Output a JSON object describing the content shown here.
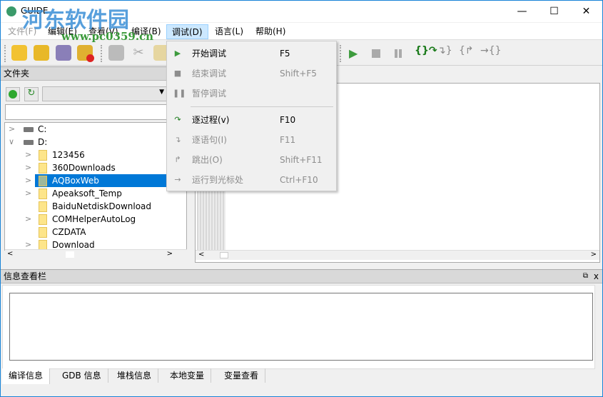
{
  "window": {
    "title": "GUIDE",
    "watermark": "河东软件园",
    "watermark_url": "www.pc0359.cn"
  },
  "menu": [
    "文件(F)",
    "编辑(E)",
    "查看(V)",
    "编译(B)",
    "调试(D)",
    "语言(L)",
    "帮助(H)"
  ],
  "debug_menu": [
    {
      "label": "开始调试",
      "shortcut": "F5",
      "icon": "play-icon",
      "enabled": true
    },
    {
      "label": "结束调试",
      "shortcut": "Shift+F5",
      "icon": "stop-icon",
      "enabled": false
    },
    {
      "label": "暂停调试",
      "shortcut": "",
      "icon": "pause-icon",
      "enabled": false
    },
    {
      "label": "逐过程(v)",
      "shortcut": "F10",
      "icon": "step-over-icon",
      "enabled": true
    },
    {
      "label": "逐语句(I)",
      "shortcut": "F11",
      "icon": "step-into-icon",
      "enabled": false
    },
    {
      "label": "跳出(O)",
      "shortcut": "Shift+F11",
      "icon": "step-out-icon",
      "enabled": false
    },
    {
      "label": "运行到光标处",
      "shortcut": "Ctrl+F10",
      "icon": "run-to-cursor-icon",
      "enabled": false
    }
  ],
  "folder_panel": {
    "title": "文件夹",
    "path_value": "",
    "drives": [
      "C:",
      "D:"
    ],
    "folders": [
      "123456",
      "360Downloads",
      "AQBoxWeb",
      "Apeaksoft_Temp",
      "BaiduNetdiskDownload",
      "COMHelperAutoLog",
      "CZDATA",
      "Download"
    ],
    "selected": "AQBoxWeb"
  },
  "info_panel": {
    "title": "信息查看栏",
    "tabs": [
      "编译信息",
      "GDB 信息",
      "堆栈信息",
      "本地变量",
      "变量查看"
    ],
    "active_tab": "编译信息"
  },
  "colors": {
    "accent": "#0078d7",
    "play": "#3d9b3d"
  }
}
